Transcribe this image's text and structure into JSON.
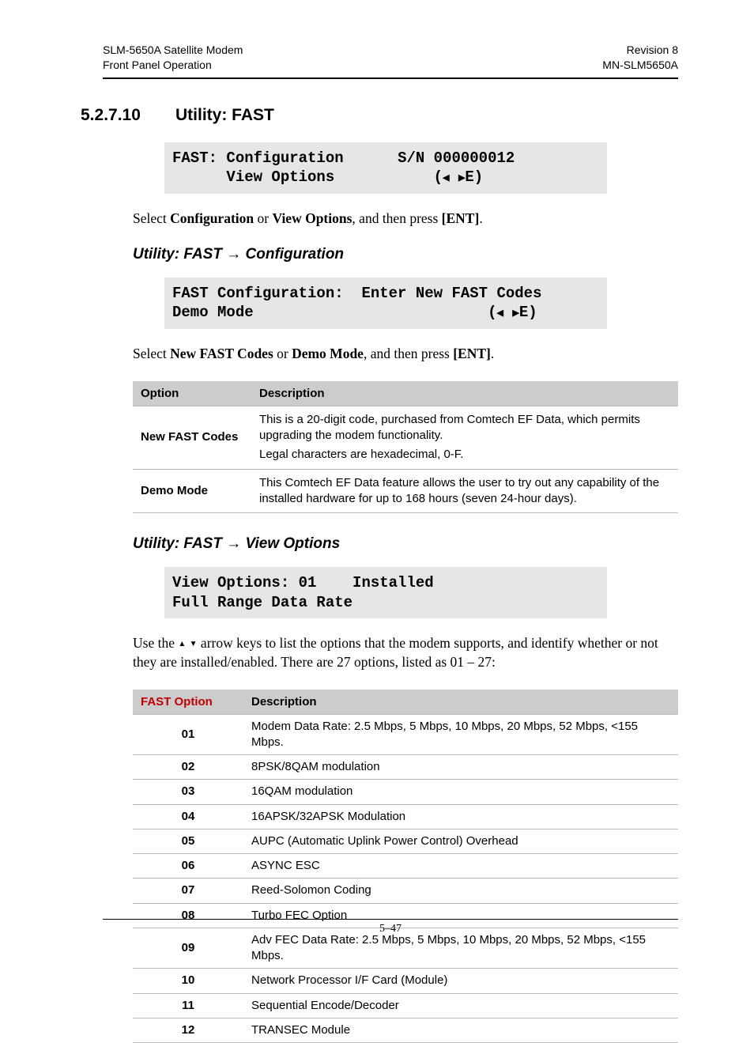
{
  "header": {
    "left1": "SLM-5650A Satellite Modem",
    "left2": "Front Panel Operation",
    "right1": "Revision 8",
    "right2": "MN-SLM5650A"
  },
  "section": {
    "number": "5.2.7.10",
    "title": "Utility: FAST"
  },
  "lcd1": {
    "line1a": "FAST: Configuration",
    "line1b": "S/N 000000012",
    "line2a": "      View Options",
    "nav_pre": "(",
    "nav_e": "E)"
  },
  "para1": {
    "pre": "Select ",
    "b1": "Configuration",
    "mid": " or ",
    "b2": "View Options",
    "mid2": ", and then press ",
    "b3": "[ENT]",
    "post": "."
  },
  "sub1": {
    "pre": "Utility: FAST ",
    "post": " Configuration"
  },
  "lcd2": {
    "line1": "FAST Configuration:  Enter New FAST Codes",
    "line2a": "Demo Mode",
    "nav_pre": "(",
    "nav_e": "E)"
  },
  "para2": {
    "pre": "Select ",
    "b1": "New FAST Codes",
    "mid": " or ",
    "b2": "Demo Mode",
    "mid2": ", and then press ",
    "b3": "[ENT]",
    "post": "."
  },
  "table1": {
    "h1": "Option",
    "h2": "Description",
    "rows": [
      {
        "opt": "New FAST Codes",
        "desc_l1": "This is a 20-digit code, purchased from Comtech EF Data, which permits upgrading the modem functionality.",
        "desc_l2": "Legal characters are hexadecimal, 0-F."
      },
      {
        "opt": "Demo Mode",
        "desc_l1": "This Comtech EF Data feature allows the user to try out any capability of the installed hardware for up to 168 hours (seven 24-hour days)."
      }
    ]
  },
  "sub2": {
    "pre": "Utility: FAST ",
    "post": " View Options"
  },
  "lcd3": {
    "line1": "View Options: 01    Installed",
    "line2": "Full Range Data Rate"
  },
  "para3": {
    "pre": "Use the ",
    "post": " arrow keys to list the options that the modem supports, and identify whether or not they are installed/enabled. There are 27 options, listed as 01 – 27:"
  },
  "table2": {
    "h1": "FAST Option",
    "h2": "Description",
    "rows": [
      {
        "opt": "01",
        "desc": "Modem Data Rate: 2.5 Mbps, 5 Mbps, 10 Mbps, 20 Mbps, 52 Mbps, <155 Mbps."
      },
      {
        "opt": "02",
        "desc": "8PSK/8QAM modulation"
      },
      {
        "opt": "03",
        "desc": "16QAM modulation"
      },
      {
        "opt": "04",
        "desc": "16APSK/32APSK Modulation"
      },
      {
        "opt": "05",
        "desc": "AUPC (Automatic Uplink Power Control) Overhead"
      },
      {
        "opt": "06",
        "desc": "ASYNC ESC"
      },
      {
        "opt": "07",
        "desc": "Reed-Solomon Coding"
      },
      {
        "opt": "08",
        "desc": "Turbo FEC Option"
      },
      {
        "opt": "09",
        "desc": "Adv FEC Data Rate: 2.5 Mbps, 5 Mbps, 10 Mbps, 20 Mbps, 52 Mbps, <155 Mbps."
      },
      {
        "opt": "10",
        "desc": "Network Processor I/F Card (Module)"
      },
      {
        "opt": "11",
        "desc": "Sequential Encode/Decoder"
      },
      {
        "opt": "12",
        "desc": "TRANSEC Module"
      }
    ]
  },
  "footer": {
    "page": "5–47"
  }
}
